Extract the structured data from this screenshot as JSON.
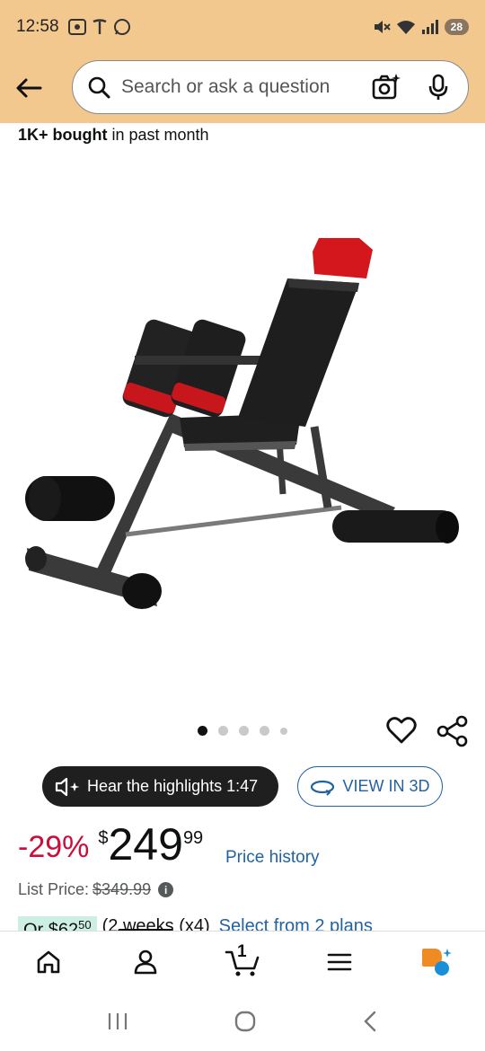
{
  "status_bar": {
    "time": "12:58",
    "battery": "28",
    "icons": [
      "screenshot-icon",
      "tesla-icon",
      "whatsapp-icon",
      "mute-icon",
      "wifi-icon",
      "signal-icon"
    ]
  },
  "header": {
    "search_placeholder": "Search or ask a question",
    "accent_color": "#f3c88f"
  },
  "social_proof": {
    "bold": "1K+ bought",
    "rest": " in past month"
  },
  "carousel": {
    "total_dots": 5,
    "active_index": 0
  },
  "actions": {
    "hear_label": "Hear the highlights 1:47",
    "view3d_label": "VIEW IN 3D"
  },
  "price": {
    "discount": "-29%",
    "currency": "$",
    "whole": "249",
    "fraction": "99",
    "history_label": "Price history",
    "list_label": "List Price:",
    "list_value": "$349.99"
  },
  "installment": {
    "text_prefix": "Or ",
    "currency": "$",
    "amount": "62",
    "fraction": "50",
    "plan": "(2 weeks (x4)",
    "link": "Select from 2 plans"
  },
  "bottom_nav": {
    "cart_count": "1",
    "items": [
      "home-icon",
      "account-icon",
      "cart-icon",
      "menu-icon",
      "rufus-icon"
    ]
  },
  "colors": {
    "discount": "#cc0c39",
    "link": "#2162a1",
    "price_text": "#0f1111"
  }
}
